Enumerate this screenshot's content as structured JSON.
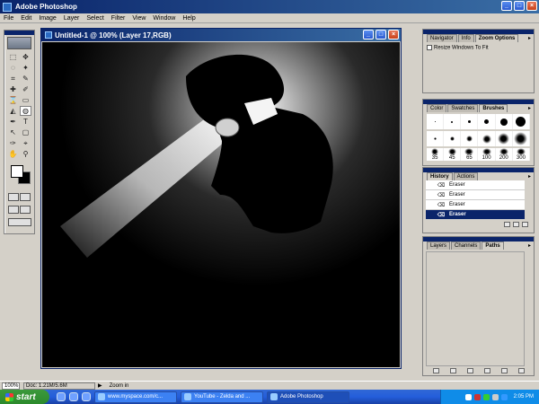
{
  "app": {
    "title": "Adobe Photoshop",
    "btn_min": "_",
    "btn_max": "□",
    "btn_close": "×"
  },
  "menu": [
    "File",
    "Edit",
    "Image",
    "Layer",
    "Select",
    "Filter",
    "View",
    "Window",
    "Help"
  ],
  "tools": [
    "⬚",
    "✥",
    "◌",
    "✦",
    "⌗",
    "✎",
    "✚",
    "✐",
    "⌛",
    "▭",
    "◭",
    "◍",
    "✒",
    "T",
    "↖",
    "▢",
    "✑",
    "⌖",
    "✋",
    "⚲"
  ],
  "document": {
    "title": "Untitled-1 @ 100% (Layer 17,RGB)"
  },
  "navigator_palette": {
    "tabs": [
      "Navigator",
      "Info",
      "Zoom Options"
    ],
    "active_tab": "Zoom Options",
    "option": "Resize Windows To Fit"
  },
  "brushes_palette": {
    "tabs": [
      "Color",
      "Swatches",
      "Brushes"
    ],
    "active_tab": "Brushes",
    "labels": [
      "35",
      "45",
      "65",
      "100",
      "200",
      "300"
    ]
  },
  "history_palette": {
    "tabs": [
      "History",
      "Actions"
    ],
    "active_tab": "History",
    "items": [
      {
        "label": "Eraser"
      },
      {
        "label": "Eraser"
      },
      {
        "label": "Eraser"
      },
      {
        "label": "Eraser",
        "selected": true
      }
    ]
  },
  "layers_palette": {
    "tabs": [
      "Layers",
      "Channels",
      "Paths"
    ],
    "active_tab": "Paths"
  },
  "status": {
    "zoom": "100%",
    "doc": "Doc: 1.21M/5.6M",
    "hint": "Zoom in"
  },
  "taskbar": {
    "start": "start",
    "tasks": [
      {
        "label": "www.myspace.com/c..."
      },
      {
        "label": "YouTube - Zelda and ..."
      },
      {
        "label": "Adobe Photoshop",
        "active": true
      }
    ],
    "clock": "2:05 PM"
  },
  "colors": {
    "titlebar": "#0a246a",
    "taskbar": "#245edb",
    "start": "#3c9a3c"
  }
}
